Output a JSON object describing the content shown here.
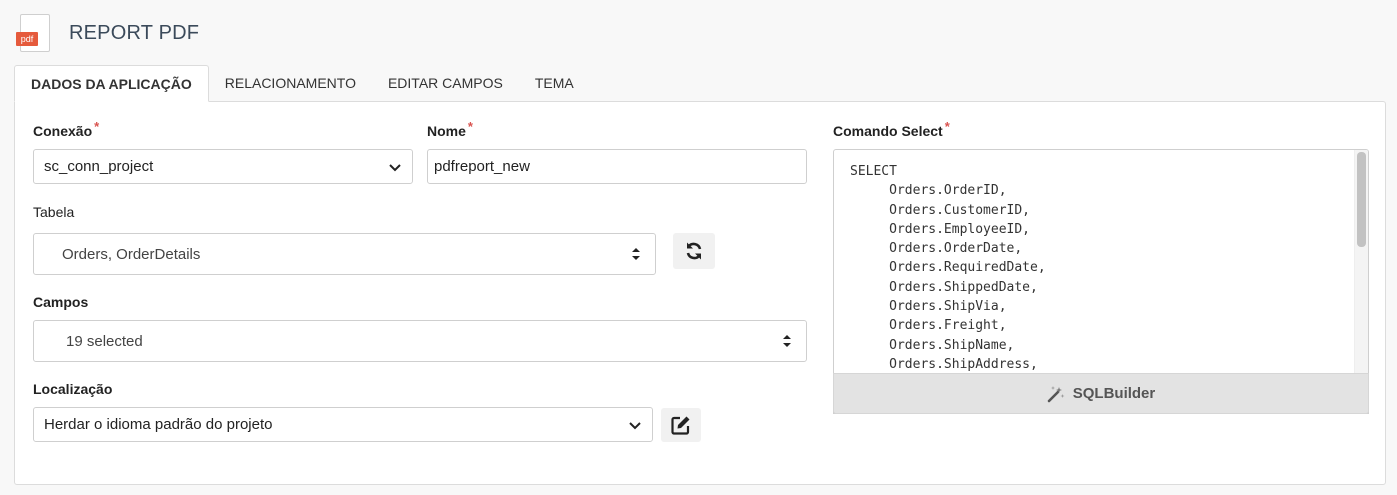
{
  "header": {
    "icon_tag": "pdf",
    "title": "REPORT PDF"
  },
  "tabs": [
    {
      "label": "DADOS DA APLICAÇÃO",
      "active": true
    },
    {
      "label": "RELACIONAMENTO",
      "active": false
    },
    {
      "label": "EDITAR CAMPOS",
      "active": false
    },
    {
      "label": "TEMA",
      "active": false
    }
  ],
  "form": {
    "conexao": {
      "label": "Conexão",
      "required_mark": "*",
      "value": "sc_conn_project"
    },
    "nome": {
      "label": "Nome",
      "required_mark": "*",
      "value": "pdfreport_new"
    },
    "tabela": {
      "label": "Tabela",
      "value": "Orders, OrderDetails",
      "refresh_icon": "refresh-icon"
    },
    "campos": {
      "label": "Campos",
      "value": "19 selected"
    },
    "localizacao": {
      "label": "Localização",
      "value": "Herdar o idioma padrão do projeto",
      "edit_icon": "edit-icon"
    },
    "comando_select": {
      "label": "Comando Select",
      "required_mark": "*",
      "code": "SELECT\n     Orders.OrderID,\n     Orders.CustomerID,\n     Orders.EmployeeID,\n     Orders.OrderDate,\n     Orders.RequiredDate,\n     Orders.ShippedDate,\n     Orders.ShipVia,\n     Orders.Freight,\n     Orders.ShipName,\n     Orders.ShipAddress,"
    },
    "sqlbuilder": {
      "label": "SQLBuilder",
      "icon": "magic-wand-icon"
    }
  },
  "colors": {
    "required": "#d9534f",
    "pdf_tag": "#e55a3c",
    "title": "#3b4a5a"
  }
}
